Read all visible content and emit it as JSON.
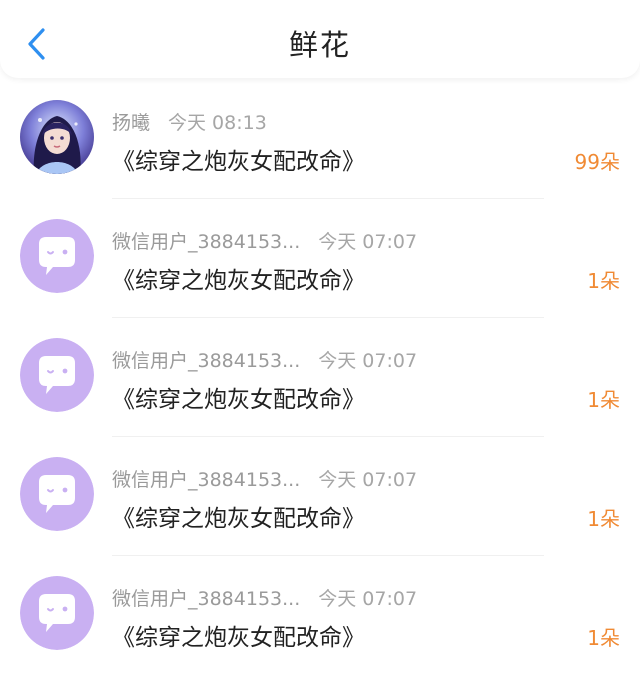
{
  "header": {
    "title": "鲜花",
    "back_icon": "chevron-left-icon",
    "accent_color": "#2e8ff0"
  },
  "colors": {
    "count": "#f08a34",
    "default_avatar_bg": "#c9b0f2"
  },
  "records": [
    {
      "user": "扬曦",
      "time": "今天 08:13",
      "book": "《综穿之炮灰女配改命》",
      "count": "99朵",
      "avatar": "user-photo"
    },
    {
      "user": "微信用户_3884153...",
      "time": "今天 07:07",
      "book": "《综穿之炮灰女配改命》",
      "count": "1朵",
      "avatar": "default-chat-icon"
    },
    {
      "user": "微信用户_3884153...",
      "time": "今天 07:07",
      "book": "《综穿之炮灰女配改命》",
      "count": "1朵",
      "avatar": "default-chat-icon"
    },
    {
      "user": "微信用户_3884153...",
      "time": "今天 07:07",
      "book": "《综穿之炮灰女配改命》",
      "count": "1朵",
      "avatar": "default-chat-icon"
    },
    {
      "user": "微信用户_3884153...",
      "time": "今天 07:07",
      "book": "《综穿之炮灰女配改命》",
      "count": "1朵",
      "avatar": "default-chat-icon"
    }
  ]
}
